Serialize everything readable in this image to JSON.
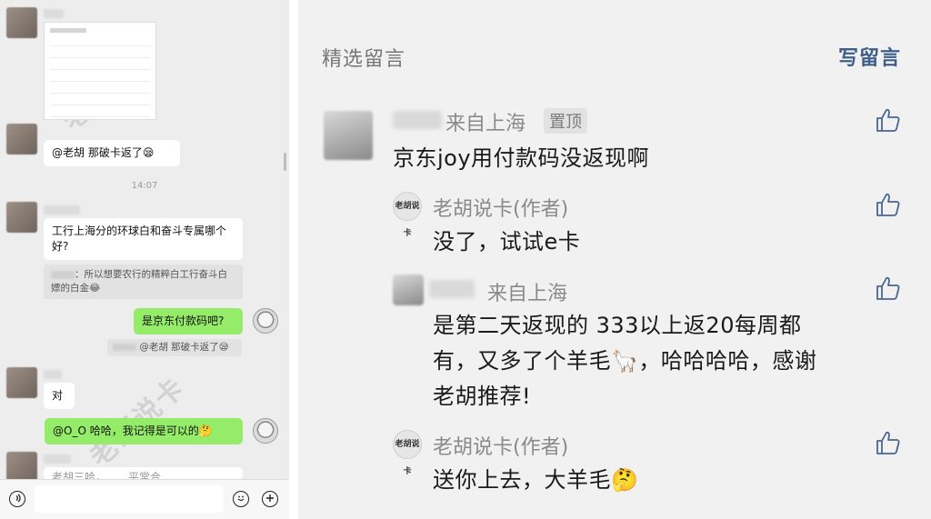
{
  "chat": {
    "watermark_text": "老胡说卡",
    "messages": {
      "m1_text": "@老胡  那破卡返了😪",
      "time1": "14:07",
      "m2_text": "工行上海分的环球白和奋斗专属哪个好?",
      "m2_quote": "：所以想要农行的精粹白工行奋斗白嫖的白金😂",
      "m3_text": "是京东付款码吧?",
      "m3_quote": "@老胡 那破卡返了😪",
      "m4_text": "对",
      "m5_text": "@O_O  哈哈，我记得是可以的🤔",
      "m6_partial": "老胡三哈，……平常合……"
    },
    "input_bar": {
      "voice_icon": "voice-icon",
      "emoji_icon": "emoji-icon",
      "plus_icon": "plus-icon"
    }
  },
  "comments": {
    "header_title": "精选留言",
    "write_label": "写留言",
    "items": [
      {
        "location": "来自上海",
        "pinned_label": "置顶",
        "text": "京东joy用付款码没返现啊",
        "reply": {
          "author": "老胡说卡(作者)",
          "text": "没了，试试e卡"
        }
      },
      {
        "location": "来自上海",
        "text_line1": "是第二天返现的 333以上返20每周都",
        "text_line2": "有，又多了个羊毛🦙，哈哈哈哈，感谢",
        "text_line3": "老胡推荐!",
        "reply": {
          "author": "老胡说卡(作者)",
          "text": "送你上去，大羊毛🤔"
        }
      }
    ],
    "author_avatar_text": "老胡说卡",
    "like_icon": "thumbs-up-icon"
  },
  "colors": {
    "chat_bg": "#ededed",
    "green_bubble": "#95ec69",
    "comments_bg": "#f1f1f1",
    "link_blue": "#3e5f8a"
  }
}
